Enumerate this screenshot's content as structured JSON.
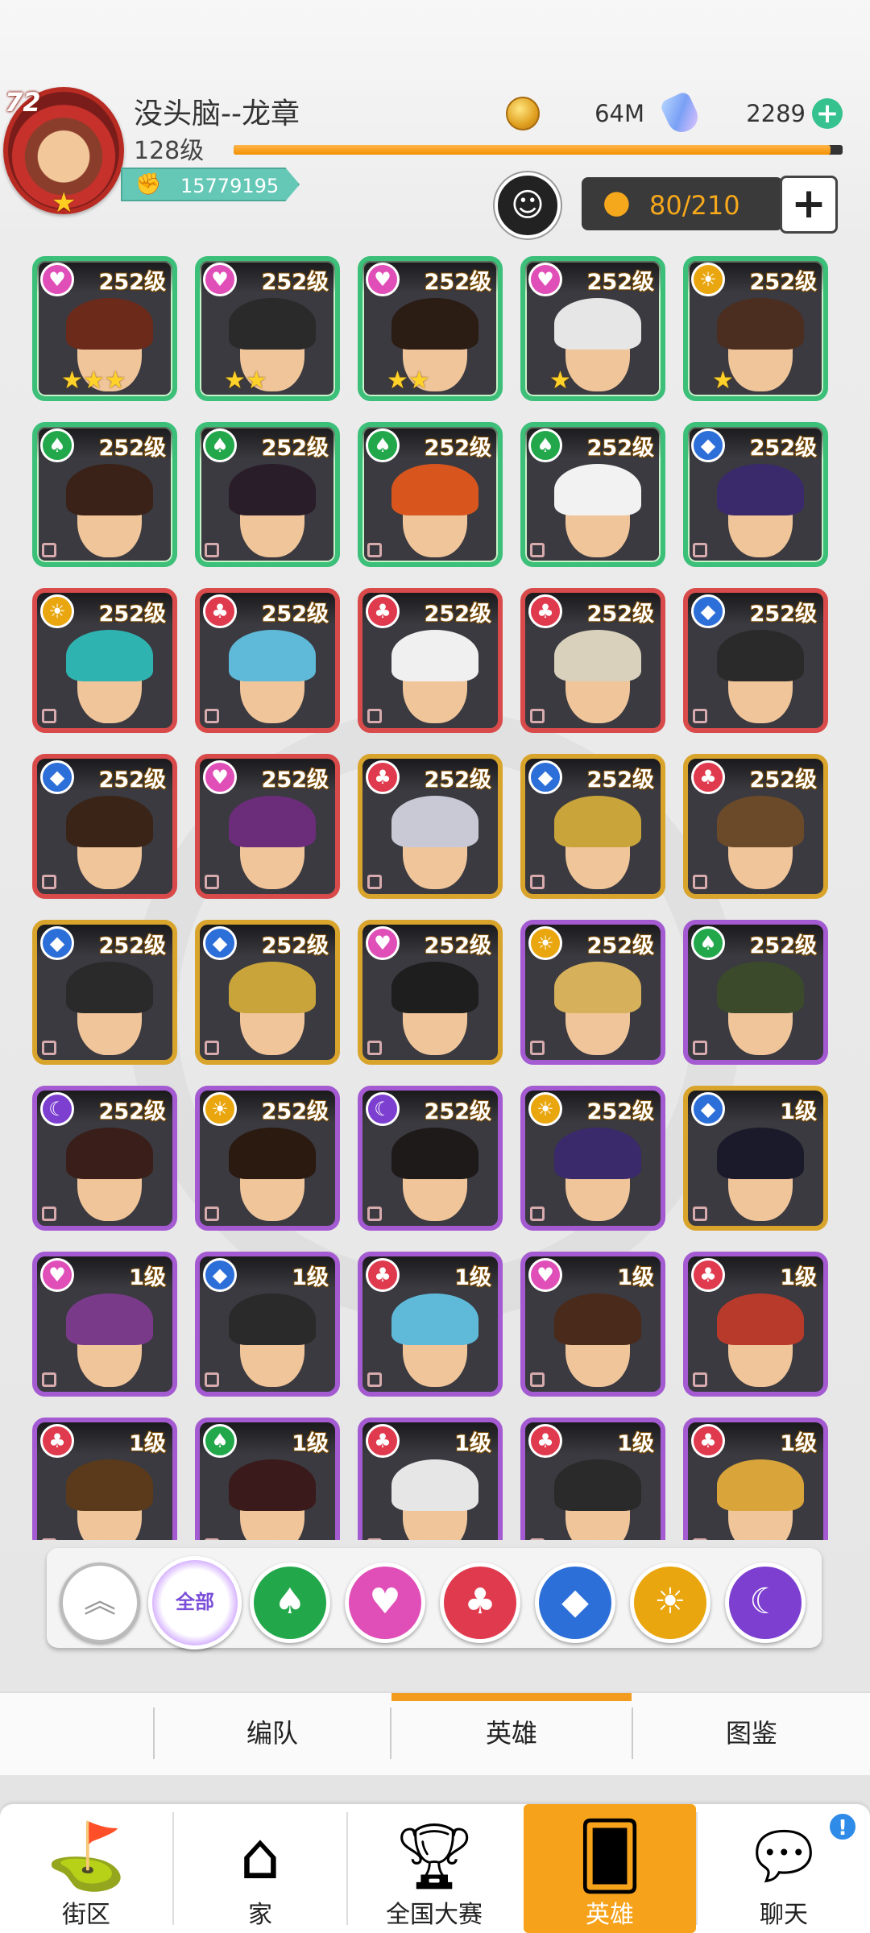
{
  "player": {
    "avatar_level": "72",
    "name": "没头脑--龙章",
    "level": "128级",
    "power": "15779195",
    "exp_progress": 0.98
  },
  "resources": {
    "coins": "64M",
    "gems": "2289"
  },
  "roster": {
    "capacity": "80/210"
  },
  "icons": {
    "coin": "coin-icon",
    "gem": "gem-icon",
    "add": "plus-icon",
    "team": "team-formation-icon",
    "person": "person-icon"
  },
  "element_colors": {
    "heart": "#e04fb8",
    "spade": "#22a84a",
    "sun": "#e9a60e",
    "club": "#e03a4e",
    "diamond": "#2d6fd8",
    "moon": "#7c3fd0"
  },
  "heroes": [
    {
      "level": "252级",
      "element": "heart",
      "rarity": "green",
      "stars": "★★★",
      "hair": "#6b2a1a"
    },
    {
      "level": "252级",
      "element": "heart",
      "rarity": "green",
      "stars": "★★",
      "hair": "#2a2a2a"
    },
    {
      "level": "252级",
      "element": "heart",
      "rarity": "green",
      "stars": "★★",
      "hair": "#2b1c14"
    },
    {
      "level": "252级",
      "element": "heart",
      "rarity": "green",
      "stars": "★",
      "hair": "#e6e6e6"
    },
    {
      "level": "252级",
      "element": "sun",
      "rarity": "green",
      "stars": "★",
      "hair": "#4b2e1f"
    },
    {
      "level": "252级",
      "element": "spade",
      "rarity": "green",
      "stars": "",
      "hair": "#3a2218"
    },
    {
      "level": "252级",
      "element": "spade",
      "rarity": "green",
      "stars": "",
      "hair": "#2a1d2a"
    },
    {
      "level": "252级",
      "element": "spade",
      "rarity": "green",
      "stars": "",
      "hair": "#d8561e"
    },
    {
      "level": "252级",
      "element": "spade",
      "rarity": "green",
      "stars": "",
      "hair": "#f2f2f2"
    },
    {
      "level": "252级",
      "element": "diamond",
      "rarity": "green",
      "stars": "",
      "hair": "#3b2a6b"
    },
    {
      "level": "252级",
      "element": "sun",
      "rarity": "red",
      "stars": "",
      "hair": "#2fb3b0"
    },
    {
      "level": "252级",
      "element": "club",
      "rarity": "red",
      "stars": "",
      "hair": "#5fb9d9"
    },
    {
      "level": "252级",
      "element": "club",
      "rarity": "red",
      "stars": "",
      "hair": "#f0f0f0"
    },
    {
      "level": "252级",
      "element": "club",
      "rarity": "red",
      "stars": "",
      "hair": "#d9d1bc"
    },
    {
      "level": "252级",
      "element": "diamond",
      "rarity": "red",
      "stars": "",
      "hair": "#2a2a2a"
    },
    {
      "level": "252级",
      "element": "diamond",
      "rarity": "red",
      "stars": "",
      "hair": "#3a2418"
    },
    {
      "level": "252级",
      "element": "heart",
      "rarity": "red",
      "stars": "",
      "hair": "#6b2d7a"
    },
    {
      "level": "252级",
      "element": "club",
      "rarity": "gold",
      "stars": "",
      "hair": "#c9c9d6"
    },
    {
      "level": "252级",
      "element": "diamond",
      "rarity": "gold",
      "stars": "",
      "hair": "#c9a43a"
    },
    {
      "level": "252级",
      "element": "club",
      "rarity": "gold",
      "stars": "",
      "hair": "#6b4a2a"
    },
    {
      "level": "252级",
      "element": "diamond",
      "rarity": "gold",
      "stars": "",
      "hair": "#2a2a2a"
    },
    {
      "level": "252级",
      "element": "diamond",
      "rarity": "gold",
      "stars": "",
      "hair": "#c9a43a"
    },
    {
      "level": "252级",
      "element": "heart",
      "rarity": "gold",
      "stars": "",
      "hair": "#1e1e1e"
    },
    {
      "level": "252级",
      "element": "sun",
      "rarity": "purple",
      "stars": "",
      "hair": "#d6b05a"
    },
    {
      "level": "252级",
      "element": "spade",
      "rarity": "purple",
      "stars": "",
      "hair": "#3a4a2a"
    },
    {
      "level": "252级",
      "element": "moon",
      "rarity": "purple",
      "stars": "",
      "hair": "#3a1e1a"
    },
    {
      "level": "252级",
      "element": "sun",
      "rarity": "purple",
      "stars": "",
      "hair": "#2a1a10"
    },
    {
      "level": "252级",
      "element": "moon",
      "rarity": "purple",
      "stars": "",
      "hair": "#1e1a1a"
    },
    {
      "level": "252级",
      "element": "sun",
      "rarity": "purple",
      "stars": "",
      "hair": "#3a2a6b"
    },
    {
      "level": "1级",
      "element": "diamond",
      "rarity": "gold",
      "stars": "",
      "hair": "#1a1a2a"
    },
    {
      "level": "1级",
      "element": "heart",
      "rarity": "purple",
      "stars": "",
      "hair": "#7a3a8a"
    },
    {
      "level": "1级",
      "element": "diamond",
      "rarity": "purple",
      "stars": "",
      "hair": "#2a2a2a"
    },
    {
      "level": "1级",
      "element": "club",
      "rarity": "purple",
      "stars": "",
      "hair": "#5fb9d9"
    },
    {
      "level": "1级",
      "element": "heart",
      "rarity": "purple",
      "stars": "",
      "hair": "#4a2a1a"
    },
    {
      "level": "1级",
      "element": "club",
      "rarity": "purple",
      "stars": "",
      "hair": "#b83a2a"
    },
    {
      "level": "1级",
      "element": "club",
      "rarity": "purple",
      "stars": "",
      "hair": "#5a3a1a"
    },
    {
      "level": "1级",
      "element": "spade",
      "rarity": "purple",
      "stars": "",
      "hair": "#3a1a1a"
    },
    {
      "level": "1级",
      "element": "club",
      "rarity": "purple",
      "stars": "",
      "hair": "#e6e6e6"
    },
    {
      "level": "1级",
      "element": "club",
      "rarity": "purple",
      "stars": "",
      "hair": "#2a2a2a"
    },
    {
      "level": "1级",
      "element": "club",
      "rarity": "purple",
      "stars": "",
      "hair": "#d9a43a"
    }
  ],
  "filters": {
    "collapse_icon": "double-chevron-up-icon",
    "all_label": "全部",
    "elements": [
      "spade",
      "heart",
      "club",
      "diamond",
      "sun",
      "moon"
    ]
  },
  "tabs": {
    "formation": "编队",
    "heroes": "英雄",
    "codex": "图鉴"
  },
  "nav": {
    "street": "街区",
    "home": "家",
    "tournament": "全国大赛",
    "heroes": "英雄",
    "chat": "聊天",
    "chat_badge": "!"
  }
}
